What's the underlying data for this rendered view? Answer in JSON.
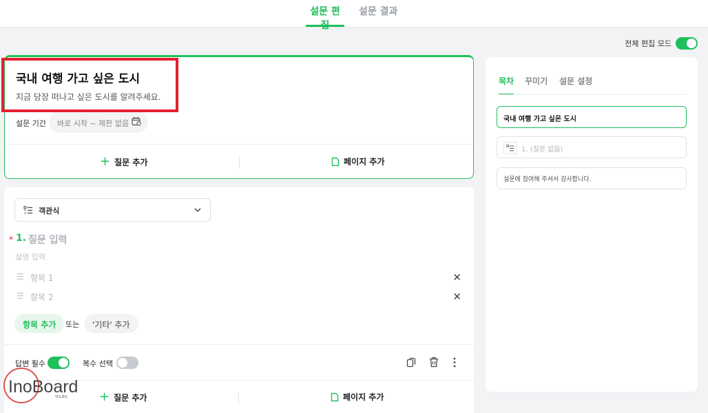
{
  "tabs": {
    "edit": "설문 편집",
    "results": "설문 결과"
  },
  "edit_mode": {
    "label": "전체 편집 모드",
    "enabled": true
  },
  "survey": {
    "title": "국내 여행 가고 싶은 도시",
    "description": "지금 당장 떠나고 싶은 도시를 알려주세요.",
    "period_label": "설문 기간",
    "period_value": "바로 시작 ~ 제한 없음"
  },
  "actions": {
    "add_question": "질문 추가",
    "add_page": "페이지 추가"
  },
  "question": {
    "type": "객관식",
    "required_mark": "*",
    "number": "1.",
    "title_placeholder": "질문 입력",
    "desc_placeholder": "설명 입력",
    "options": [
      "항목 1",
      "항목 2"
    ],
    "add_option": "항목 추가",
    "or_text": "또는",
    "add_other": "'기타' 추가",
    "required_label": "답변 필수",
    "required": true,
    "multi_label": "복수 선택",
    "multi": false
  },
  "panel": {
    "tabs": [
      "목차",
      "꾸미기",
      "설문 설정"
    ],
    "title_item": "국내 여행 가고 싶은 도시",
    "question_item": "1. (질문 없음)",
    "ending_item": "설문에 참여해 주셔서 감사합니다."
  },
  "watermark": {
    "brand": "InoBoard",
    "sub": "이노보드"
  },
  "colors": {
    "accent": "#1fbf5c",
    "highlight": "#e51f2f"
  }
}
